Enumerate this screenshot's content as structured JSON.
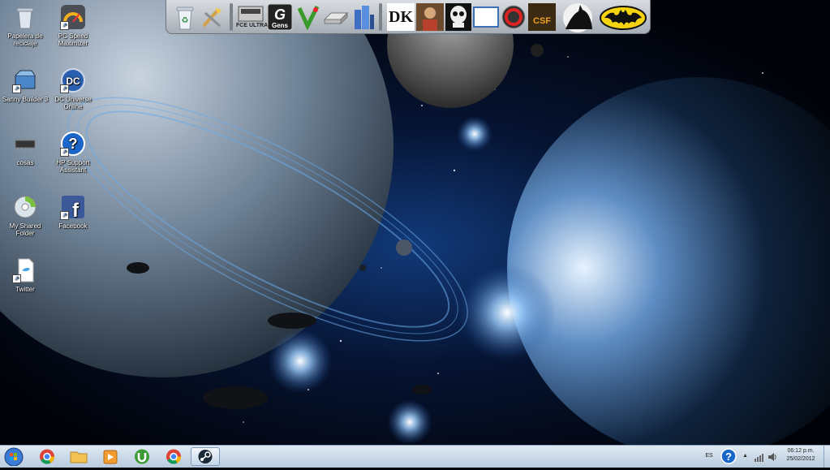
{
  "desktop": {
    "icons": [
      {
        "label": "Papelera de reciclaje",
        "icon": "recycle-bin-icon"
      },
      {
        "label": "PC Speed Maximizer",
        "icon": "speed-gauge-icon"
      },
      {
        "label": "Sanny Builder 3",
        "icon": "sanny-builder-icon"
      },
      {
        "label": "DC Universe Online",
        "icon": "dc-logo-icon"
      },
      {
        "label": "cosas",
        "icon": "chip-icon"
      },
      {
        "label": "HP Support Assistant",
        "icon": "help-question-icon"
      },
      {
        "label": "My Shared Folder",
        "icon": "cd-icon"
      },
      {
        "label": "Facebook",
        "icon": "facebook-icon"
      },
      {
        "label": "Twitter",
        "icon": "twitter-icon"
      }
    ]
  },
  "dock": {
    "items": [
      {
        "icon": "recycle-bin-icon"
      },
      {
        "icon": "tools-icon"
      },
      {
        "label": "FCE ULTRA",
        "icon": "nes-emulator-icon"
      },
      {
        "label": "Gens",
        "icon": "gens-icon"
      },
      {
        "icon": "utorrent-icon"
      },
      {
        "icon": "drive-icon"
      },
      {
        "icon": "city-buildings-icon"
      },
      {
        "label": "DK",
        "icon": "dk-icon"
      },
      {
        "icon": "man-portrait-icon"
      },
      {
        "icon": "punisher-skull-icon"
      },
      {
        "icon": "blank-window-icon"
      },
      {
        "icon": "red-circle-icon"
      },
      {
        "label": "CSF",
        "icon": "csf-icon"
      },
      {
        "icon": "batman-silhouette-icon"
      },
      {
        "icon": "batman-logo-icon"
      }
    ]
  },
  "taskbar": {
    "start_icon": "windows-start-icon",
    "pinned": [
      "chrome-icon",
      "folder-icon",
      "media-player-icon",
      "utorrent-icon",
      "chrome-icon",
      "steam-icon"
    ],
    "active_index": 5,
    "tray": {
      "language": "ES",
      "time": "06:12 p.m.",
      "date": "25/02/2012"
    }
  },
  "colors": {
    "taskbar": "#c9d9e9",
    "dock": "#bfc4ca",
    "space": "#02040a"
  }
}
